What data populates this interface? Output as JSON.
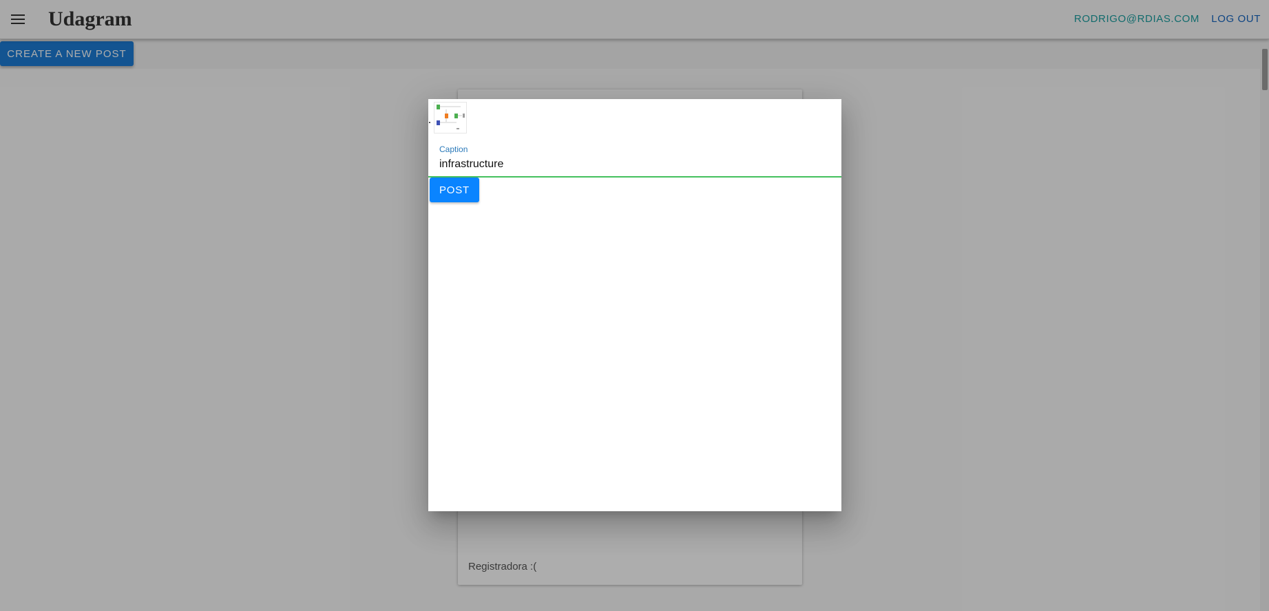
{
  "header": {
    "brand": "Udagram",
    "user_email": "RODRIGO@RDIAS.COM",
    "logout_label": "LOG OUT",
    "menu_icon": "hamburger-menu-icon"
  },
  "toolbar": {
    "create_post_label": "CREATE A NEW POST"
  },
  "feed": {
    "items": [
      {
        "caption": "Registradora :("
      }
    ]
  },
  "modal": {
    "thumbnail_icon": "image-thumbnail",
    "caption_label": "Caption",
    "caption_value": "infrastructure",
    "post_label": "POST"
  },
  "colors": {
    "primary": "#1c7cd6",
    "post_button": "#0a84ff",
    "accent_link": "#1a9ea0",
    "focus_underline": "#43c05c"
  }
}
